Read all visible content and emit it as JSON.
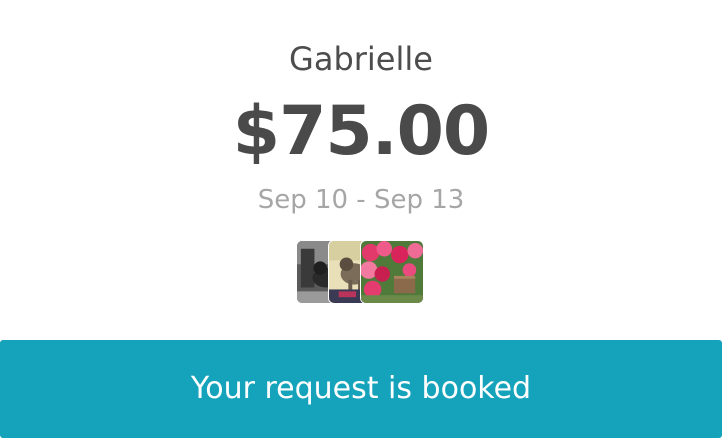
{
  "booking": {
    "host_name": "Gabrielle",
    "price": "$75.00",
    "date_range": "Sep 10 - Sep 13",
    "photos": [
      {
        "icon": "dog-photo-bw-thumbnail"
      },
      {
        "icon": "dog-photo-thumbnail"
      },
      {
        "icon": "garden-flowers-thumbnail"
      }
    ]
  },
  "action": {
    "label": "Your request is booked"
  },
  "colors": {
    "button": "#15a3bb",
    "name_text": "#4d4d4d",
    "price_text": "#4a4a4a",
    "date_text": "#a6a6a6"
  }
}
